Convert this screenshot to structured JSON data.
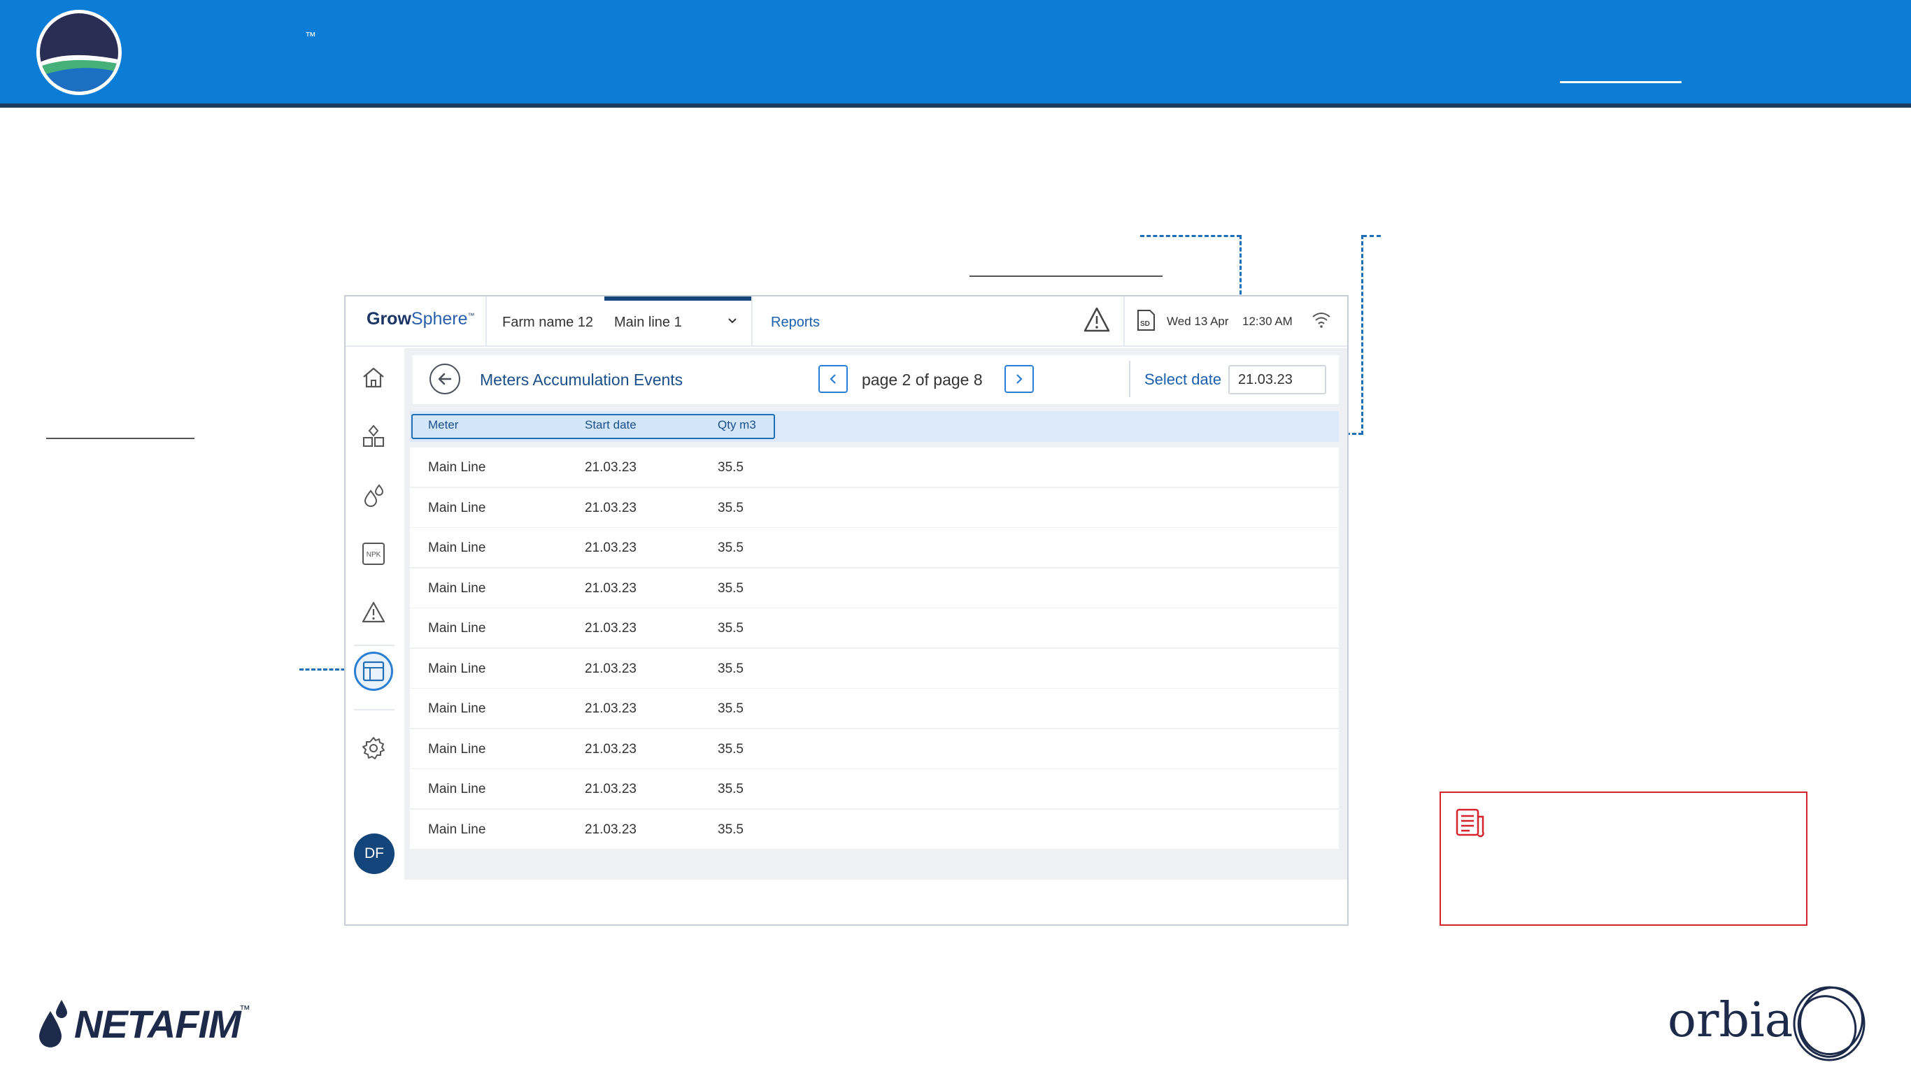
{
  "banner": {
    "trademark": "™"
  },
  "app": {
    "brand_bold": "Grow",
    "brand_light": "Sphere",
    "brand_tm": "™",
    "farm_name": "Farm name 12",
    "line_select": "Main line 1",
    "reports_tab": "Reports",
    "date": "Wed 13 Apr",
    "time": "12:30 AM"
  },
  "sidebar": {
    "icons": [
      "home-icon",
      "sensors-icon",
      "fertigation-icon",
      "npk-icon",
      "alarm-icon",
      "reports-table-icon",
      "settings-icon"
    ],
    "active": "reports-table-icon",
    "npk_label": "NPK",
    "user_initials": "DF"
  },
  "page": {
    "title": "Meters Accumulation Events",
    "pagination": "page 2 of page 8",
    "select_date_label": "Select date",
    "select_date_value": "21.03.23"
  },
  "table": {
    "columns": [
      "Meter",
      "Start date",
      "Qty m3"
    ],
    "rows": [
      [
        "Main Line",
        "21.03.23",
        "35.5"
      ],
      [
        "Main Line",
        "21.03.23",
        "35.5"
      ],
      [
        "Main Line",
        "21.03.23",
        "35.5"
      ],
      [
        "Main Line",
        "21.03.23",
        "35.5"
      ],
      [
        "Main Line",
        "21.03.23",
        "35.5"
      ],
      [
        "Main Line",
        "21.03.23",
        "35.5"
      ],
      [
        "Main Line",
        "21.03.23",
        "35.5"
      ],
      [
        "Main Line",
        "21.03.23",
        "35.5"
      ],
      [
        "Main Line",
        "21.03.23",
        "35.5"
      ],
      [
        "Main Line",
        "21.03.23",
        "35.5"
      ]
    ]
  },
  "footer": {
    "netafim": "NETAFIM",
    "netafim_tm": "™",
    "orbia": "orbia"
  },
  "colors": {
    "banner_blue": "#0b7dd6",
    "accent_blue": "#2a7fd4",
    "navy": "#14457a",
    "note_red": "#d5232b"
  }
}
